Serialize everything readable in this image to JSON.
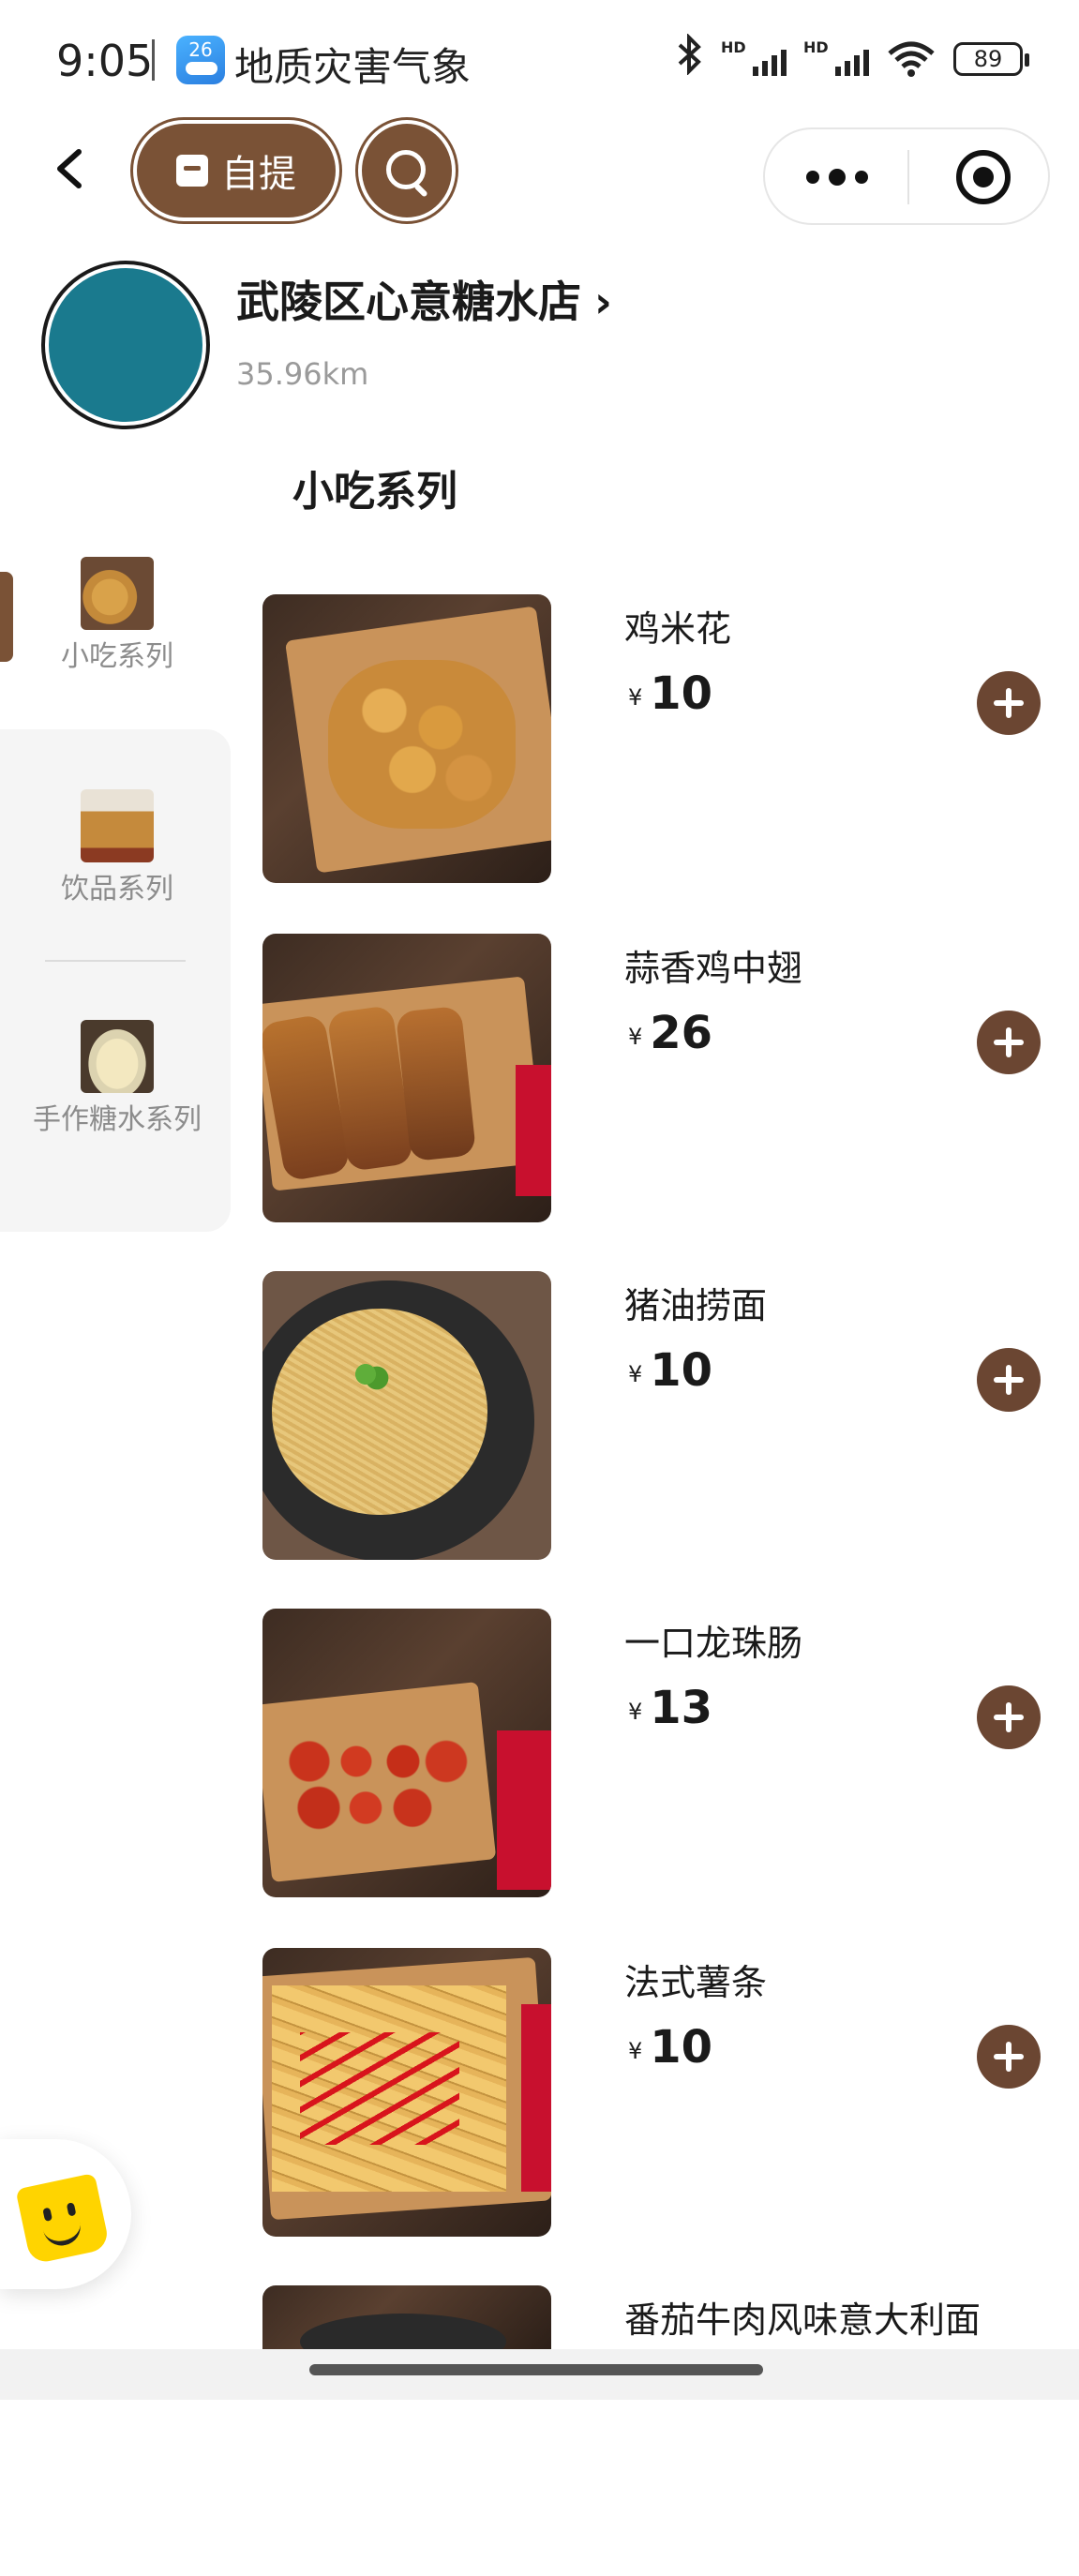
{
  "status_bar": {
    "time": "9:05",
    "notification_badge": "26",
    "notification_text": "地质灾害气象",
    "battery": "89"
  },
  "nav": {
    "pickup_label": "自提"
  },
  "store": {
    "name": "武陵区心意糖水店",
    "chevron": "›",
    "distance": "35.96km"
  },
  "section_title": "小吃系列",
  "categories": [
    {
      "label": "小吃系列",
      "active": true
    },
    {
      "label": "饮品系列",
      "active": false
    },
    {
      "label": "手作糖水系列",
      "active": false
    }
  ],
  "currency_symbol": "¥",
  "products": [
    {
      "name": "鸡米花",
      "price": "10"
    },
    {
      "name": "蒜香鸡中翅",
      "price": "26"
    },
    {
      "name": "猪油捞面",
      "price": "10"
    },
    {
      "name": "一口龙珠肠",
      "price": "13"
    },
    {
      "name": "法式薯条",
      "price": "10"
    },
    {
      "name": "番茄牛肉风味意大利面",
      "price": ""
    }
  ],
  "colors": {
    "accent": "#7a5236",
    "add_button": "#6b4632",
    "muted_text": "#9a9a9a"
  },
  "icons": [
    "back-icon",
    "bag-icon",
    "search-icon",
    "more-icon",
    "close-icon",
    "chevron-right-icon",
    "plus-icon",
    "mascot-icon",
    "bluetooth-icon",
    "signal-icon",
    "wifi-icon",
    "battery-icon"
  ]
}
